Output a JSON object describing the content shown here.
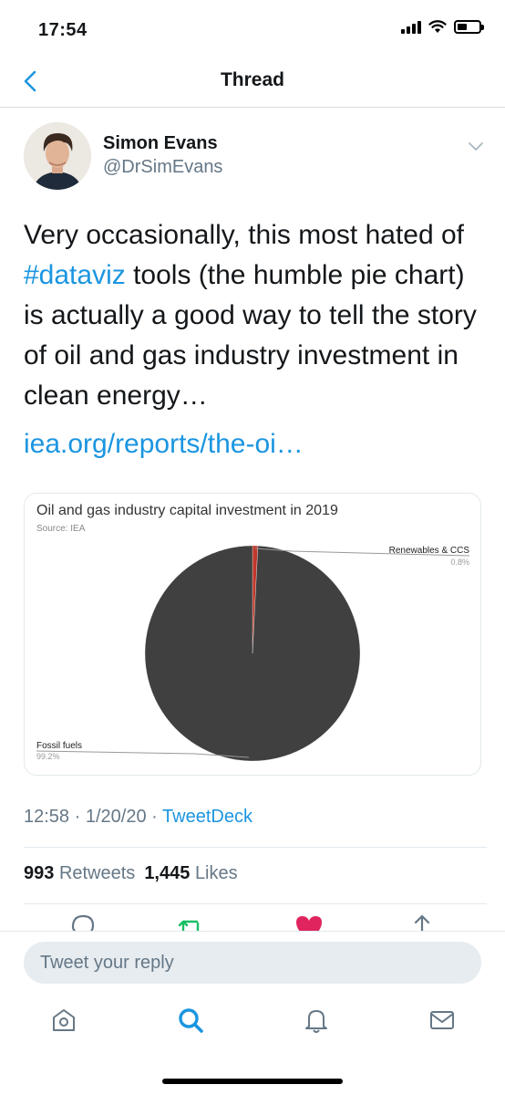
{
  "status_bar": {
    "time": "17:54",
    "battery_level": 0.45
  },
  "nav": {
    "title": "Thread"
  },
  "author": {
    "name": "Simon Evans",
    "handle": "@DrSimEvans"
  },
  "tweet": {
    "text_before": "Very occasionally, this most hated of ",
    "hashtag": "#dataviz",
    "text_after": " tools (the humble pie chart) is actually a good way to tell the story of oil and gas industry investment in clean energy…",
    "link": "iea.org/reports/the-oi…"
  },
  "chart_data": {
    "type": "pie",
    "title": "Oil and gas industry capital investment in 2019",
    "subtitle": "Source: IEA",
    "slices": [
      {
        "label": "Renewables & CCS",
        "value": 0.8,
        "display": "0.8%",
        "color": "#c0392b"
      },
      {
        "label": "Fossil fuels",
        "value": 99.2,
        "display": "99.2%",
        "color": "#404040"
      }
    ]
  },
  "meta": {
    "time": "12:58",
    "date": "1/20/20",
    "separator": "·",
    "client": "TweetDeck"
  },
  "stats": {
    "retweets_count": "993",
    "retweets_label": "Retweets",
    "likes_count": "1,445",
    "likes_label": "Likes"
  },
  "reply": {
    "placeholder": "Tweet your reply"
  },
  "colors": {
    "accent": "#1b95e0",
    "retweet": "#17bf63",
    "like": "#e0245e"
  }
}
